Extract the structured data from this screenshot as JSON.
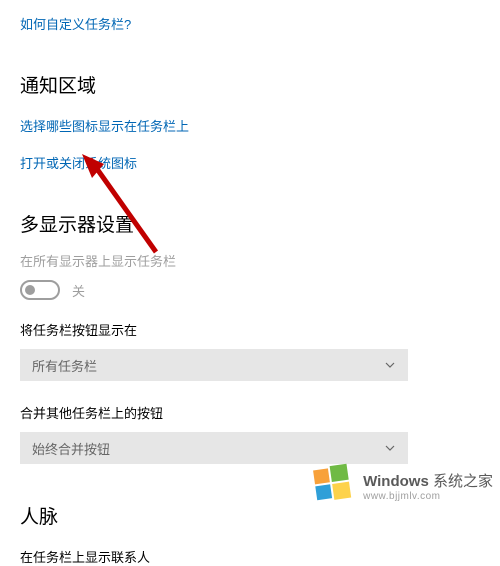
{
  "top_link": "如何自定义任务栏?",
  "notification_area": {
    "title": "通知区域",
    "link1": "选择哪些图标显示在任务栏上",
    "link2": "打开或关闭系统图标"
  },
  "multi_monitor": {
    "title": "多显示器设置",
    "show_on_all_label": "在所有显示器上显示任务栏",
    "toggle_state": "关",
    "show_buttons_label": "将任务栏按钮显示在",
    "show_buttons_value": "所有任务栏",
    "combine_label": "合并其他任务栏上的按钮",
    "combine_value": "始终合并按钮"
  },
  "people": {
    "title": "人脉",
    "show_contacts_label": "在任务栏上显示联系人"
  },
  "watermark": {
    "brand": "Windows",
    "suffix": "系统之家",
    "url": "www.bjjmlv.com"
  },
  "colors": {
    "link": "#0066b4",
    "disabled": "#9e9e9e",
    "dropdown_bg": "#e6e6e6",
    "arrow": "#c00000"
  }
}
